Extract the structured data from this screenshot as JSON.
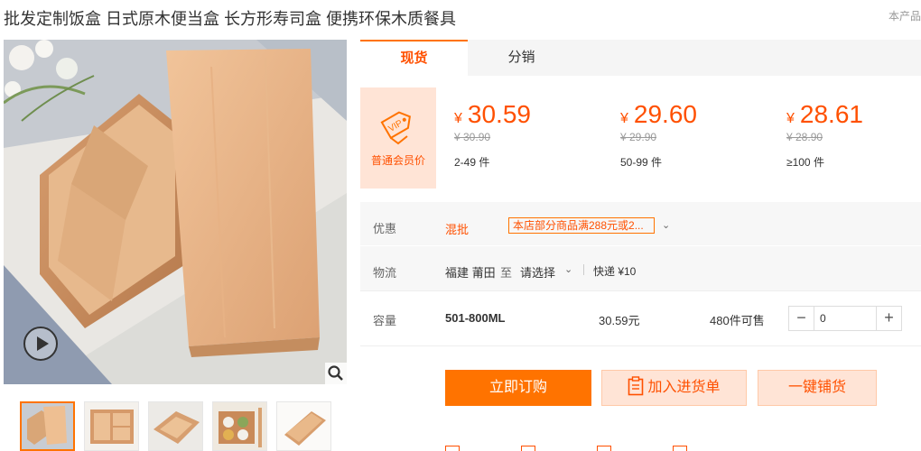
{
  "page": {
    "title": "批发定制饭盒 日式原木便当盒 长方形寿司盒 便携环保木质餐具",
    "title_note": "本产品"
  },
  "gallery": {
    "thumb_count": 5,
    "active_index": 0
  },
  "tabs": [
    {
      "label": "现货",
      "active": true
    },
    {
      "label": "分销",
      "active": false
    }
  ],
  "pricing": {
    "member_label": "普通会员价",
    "vip_text": "VIP",
    "currency": "¥",
    "tiers": [
      {
        "price": "30.59",
        "original": "¥ 30.90",
        "quantity": "2-49 件"
      },
      {
        "price": "29.60",
        "original": "¥ 29.90",
        "quantity": "50-99 件"
      },
      {
        "price": "28.61",
        "original": "¥ 28.90",
        "quantity": "≥100 件"
      }
    ]
  },
  "promotion": {
    "label": "优惠",
    "tag": "混批",
    "text": "本店部分商品满288元或2..."
  },
  "shipping": {
    "label": "物流",
    "from": "福建 莆田",
    "to": "至",
    "destination": "请选择",
    "fee": "快递 ¥10"
  },
  "sku": {
    "label": "容量",
    "name": "501-800ML",
    "price": "30.59元",
    "stock": "480件可售",
    "quantity": "0"
  },
  "actions": {
    "buy": "立即订购",
    "cart": "加入进货单",
    "distribute": "一键铺货"
  },
  "colors": {
    "accent": "#ff7300",
    "price": "#ff5000",
    "accent_light": "#ffe4d6"
  }
}
